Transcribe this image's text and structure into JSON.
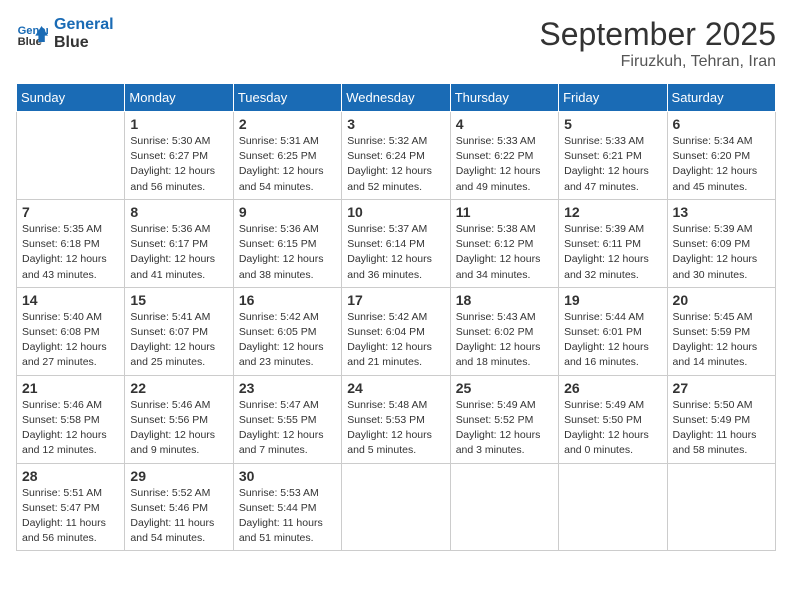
{
  "header": {
    "logo_line1": "General",
    "logo_line2": "Blue",
    "month": "September 2025",
    "location": "Firuzkuh, Tehran, Iran"
  },
  "days_of_week": [
    "Sunday",
    "Monday",
    "Tuesday",
    "Wednesday",
    "Thursday",
    "Friday",
    "Saturday"
  ],
  "weeks": [
    [
      {
        "day": "",
        "info": ""
      },
      {
        "day": "1",
        "info": "Sunrise: 5:30 AM\nSunset: 6:27 PM\nDaylight: 12 hours\nand 56 minutes."
      },
      {
        "day": "2",
        "info": "Sunrise: 5:31 AM\nSunset: 6:25 PM\nDaylight: 12 hours\nand 54 minutes."
      },
      {
        "day": "3",
        "info": "Sunrise: 5:32 AM\nSunset: 6:24 PM\nDaylight: 12 hours\nand 52 minutes."
      },
      {
        "day": "4",
        "info": "Sunrise: 5:33 AM\nSunset: 6:22 PM\nDaylight: 12 hours\nand 49 minutes."
      },
      {
        "day": "5",
        "info": "Sunrise: 5:33 AM\nSunset: 6:21 PM\nDaylight: 12 hours\nand 47 minutes."
      },
      {
        "day": "6",
        "info": "Sunrise: 5:34 AM\nSunset: 6:20 PM\nDaylight: 12 hours\nand 45 minutes."
      }
    ],
    [
      {
        "day": "7",
        "info": "Sunrise: 5:35 AM\nSunset: 6:18 PM\nDaylight: 12 hours\nand 43 minutes."
      },
      {
        "day": "8",
        "info": "Sunrise: 5:36 AM\nSunset: 6:17 PM\nDaylight: 12 hours\nand 41 minutes."
      },
      {
        "day": "9",
        "info": "Sunrise: 5:36 AM\nSunset: 6:15 PM\nDaylight: 12 hours\nand 38 minutes."
      },
      {
        "day": "10",
        "info": "Sunrise: 5:37 AM\nSunset: 6:14 PM\nDaylight: 12 hours\nand 36 minutes."
      },
      {
        "day": "11",
        "info": "Sunrise: 5:38 AM\nSunset: 6:12 PM\nDaylight: 12 hours\nand 34 minutes."
      },
      {
        "day": "12",
        "info": "Sunrise: 5:39 AM\nSunset: 6:11 PM\nDaylight: 12 hours\nand 32 minutes."
      },
      {
        "day": "13",
        "info": "Sunrise: 5:39 AM\nSunset: 6:09 PM\nDaylight: 12 hours\nand 30 minutes."
      }
    ],
    [
      {
        "day": "14",
        "info": "Sunrise: 5:40 AM\nSunset: 6:08 PM\nDaylight: 12 hours\nand 27 minutes."
      },
      {
        "day": "15",
        "info": "Sunrise: 5:41 AM\nSunset: 6:07 PM\nDaylight: 12 hours\nand 25 minutes."
      },
      {
        "day": "16",
        "info": "Sunrise: 5:42 AM\nSunset: 6:05 PM\nDaylight: 12 hours\nand 23 minutes."
      },
      {
        "day": "17",
        "info": "Sunrise: 5:42 AM\nSunset: 6:04 PM\nDaylight: 12 hours\nand 21 minutes."
      },
      {
        "day": "18",
        "info": "Sunrise: 5:43 AM\nSunset: 6:02 PM\nDaylight: 12 hours\nand 18 minutes."
      },
      {
        "day": "19",
        "info": "Sunrise: 5:44 AM\nSunset: 6:01 PM\nDaylight: 12 hours\nand 16 minutes."
      },
      {
        "day": "20",
        "info": "Sunrise: 5:45 AM\nSunset: 5:59 PM\nDaylight: 12 hours\nand 14 minutes."
      }
    ],
    [
      {
        "day": "21",
        "info": "Sunrise: 5:46 AM\nSunset: 5:58 PM\nDaylight: 12 hours\nand 12 minutes."
      },
      {
        "day": "22",
        "info": "Sunrise: 5:46 AM\nSunset: 5:56 PM\nDaylight: 12 hours\nand 9 minutes."
      },
      {
        "day": "23",
        "info": "Sunrise: 5:47 AM\nSunset: 5:55 PM\nDaylight: 12 hours\nand 7 minutes."
      },
      {
        "day": "24",
        "info": "Sunrise: 5:48 AM\nSunset: 5:53 PM\nDaylight: 12 hours\nand 5 minutes."
      },
      {
        "day": "25",
        "info": "Sunrise: 5:49 AM\nSunset: 5:52 PM\nDaylight: 12 hours\nand 3 minutes."
      },
      {
        "day": "26",
        "info": "Sunrise: 5:49 AM\nSunset: 5:50 PM\nDaylight: 12 hours\nand 0 minutes."
      },
      {
        "day": "27",
        "info": "Sunrise: 5:50 AM\nSunset: 5:49 PM\nDaylight: 11 hours\nand 58 minutes."
      }
    ],
    [
      {
        "day": "28",
        "info": "Sunrise: 5:51 AM\nSunset: 5:47 PM\nDaylight: 11 hours\nand 56 minutes."
      },
      {
        "day": "29",
        "info": "Sunrise: 5:52 AM\nSunset: 5:46 PM\nDaylight: 11 hours\nand 54 minutes."
      },
      {
        "day": "30",
        "info": "Sunrise: 5:53 AM\nSunset: 5:44 PM\nDaylight: 11 hours\nand 51 minutes."
      },
      {
        "day": "",
        "info": ""
      },
      {
        "day": "",
        "info": ""
      },
      {
        "day": "",
        "info": ""
      },
      {
        "day": "",
        "info": ""
      }
    ]
  ]
}
